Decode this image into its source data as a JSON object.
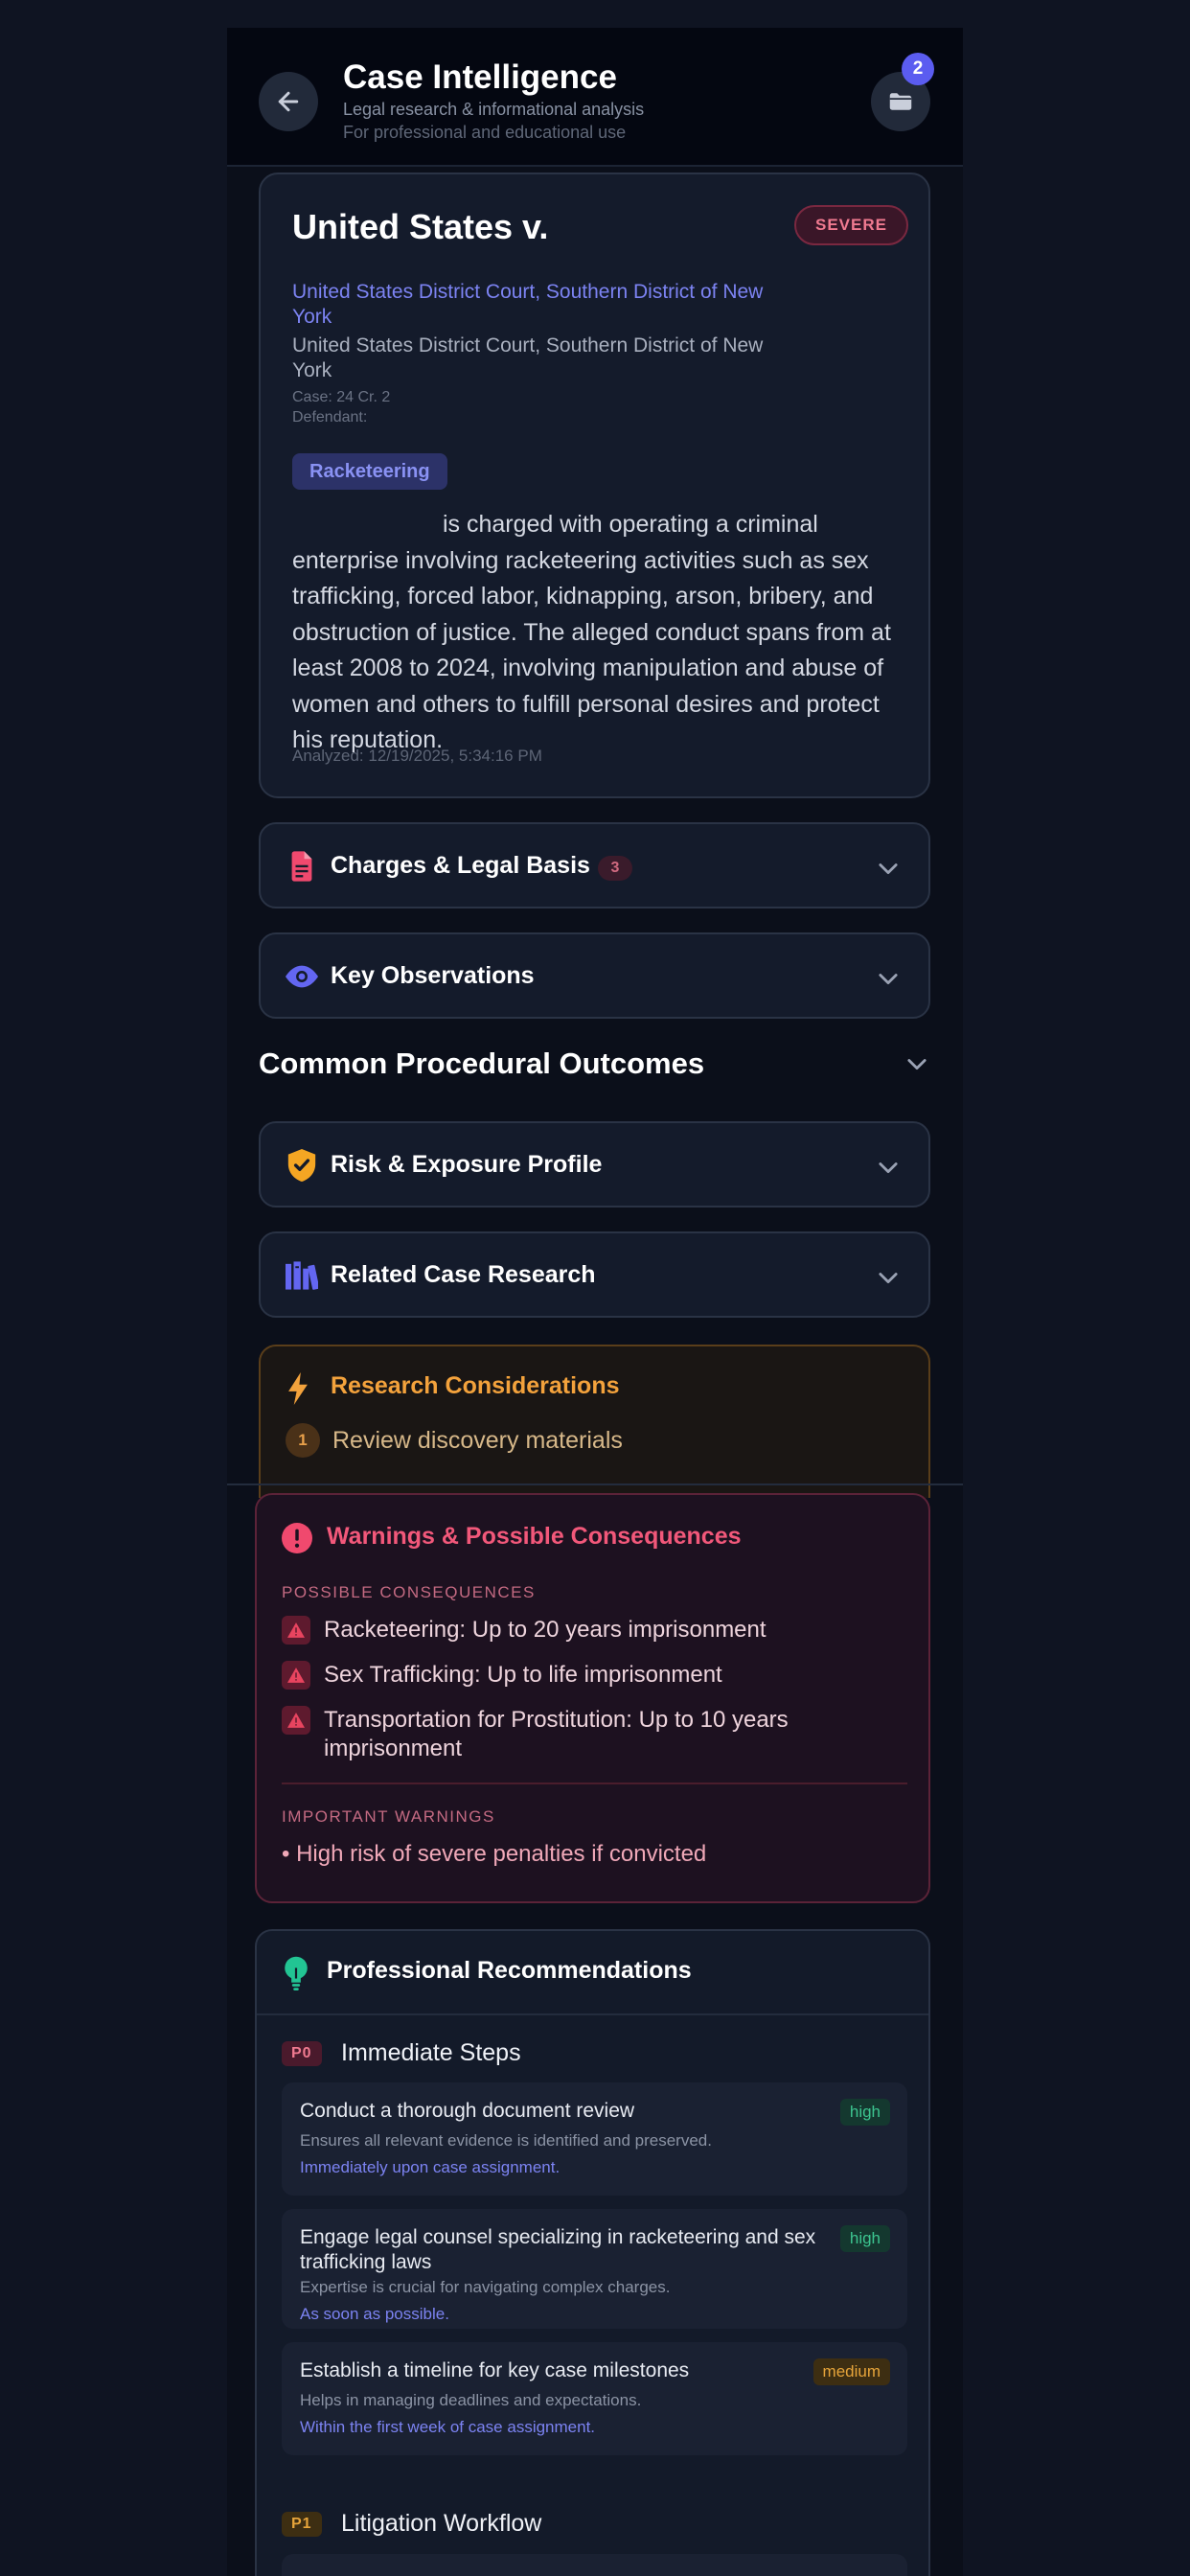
{
  "header": {
    "title": "Case Intelligence",
    "subtitle1": "Legal research & informational analysis",
    "subtitle2": "For professional and educational use",
    "folder_badge_count": "2"
  },
  "case": {
    "title": "United States v.",
    "severity": "SEVERE",
    "court_link": "United States District Court, Southern District of New York",
    "court_text": "United States District Court, Southern District of New York",
    "case_number": "Case: 24 Cr. 2",
    "defendant": "Defendant:",
    "tag": "Racketeering",
    "summary": "is charged with operating a criminal enterprise involving racketeering activities such as sex trafficking, forced labor, kidnapping, arson, bribery, and obstruction of justice. The alleged conduct spans from at least 2008 to 2024, involving manipulation and abuse of women and others to fulfill personal desires and protect his reputation.",
    "analyzed": "Analyzed: 12/19/2025, 5:34:16 PM"
  },
  "sections": {
    "charges": {
      "label": "Charges & Legal Basis",
      "count": "3",
      "icon": "document-icon"
    },
    "observations": {
      "label": "Key Observations",
      "icon": "eye-icon"
    },
    "procedural": {
      "label": "Common Procedural Outcomes"
    },
    "risk": {
      "label": "Risk & Exposure Profile",
      "icon": "shield-check-icon"
    },
    "related": {
      "label": "Related Case Research",
      "icon": "books-icon"
    }
  },
  "research": {
    "title": "Research Considerations",
    "items": [
      {
        "num": "1",
        "text": "Review discovery materials"
      }
    ]
  },
  "warnings": {
    "title": "Warnings & Possible Consequences",
    "consequences_heading": "POSSIBLE CONSEQUENCES",
    "consequences": [
      "Racketeering: Up to 20 years imprisonment",
      "Sex Trafficking: Up to life imprisonment",
      "Transportation for Prostitution: Up to 10 years imprisonment"
    ],
    "important_heading": "IMPORTANT WARNINGS",
    "important": "• High risk of severe penalties if convicted"
  },
  "recommendations": {
    "title": "Professional Recommendations",
    "groups": [
      {
        "priority": "P0",
        "label": "Immediate Steps",
        "items": [
          {
            "title": "Conduct a thorough document review",
            "desc": "Ensures all relevant evidence is identified and preserved.",
            "time": "Immediately upon case assignment.",
            "level": "high"
          },
          {
            "title": "Engage legal counsel specializing in racketeering and sex trafficking laws",
            "desc": "Expertise is crucial for navigating complex charges.",
            "time": "As soon as possible.",
            "level": "high"
          },
          {
            "title": "Establish a timeline for key case milestones",
            "desc": "Helps in managing deadlines and expectations.",
            "time": "Within the first week of case assignment.",
            "level": "medium"
          }
        ]
      },
      {
        "priority": "P1",
        "label": "Litigation Workflow"
      }
    ]
  },
  "colors": {
    "accent": "#5b5cf0",
    "severe": "#f07a90",
    "warning": "#f2587a",
    "research": "#f3a23c",
    "high": "#3cc48f",
    "medium": "#e6a43a"
  }
}
